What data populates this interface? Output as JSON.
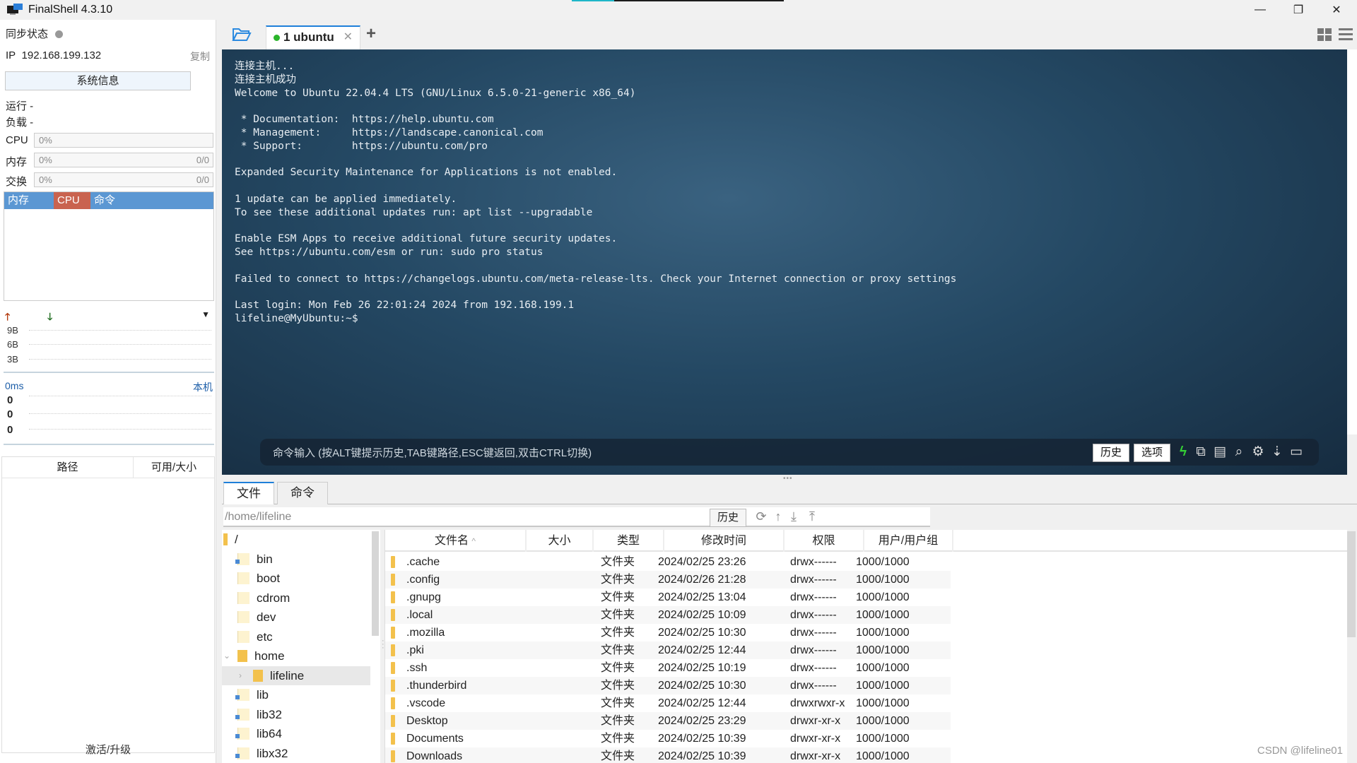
{
  "window": {
    "title": "FinalShell 4.3.10",
    "minimize_icon": "minimize-icon",
    "restore_icon": "restore-icon",
    "close_icon": "close-icon"
  },
  "left_panel": {
    "sync_label": "同步状态",
    "ip_label": "IP",
    "ip_value": "192.168.199.132",
    "copy_label": "复制",
    "sysinfo_button": "系统信息",
    "uptime_label": "运行 -",
    "load_label": "负载 -",
    "meters": [
      {
        "label": "CPU",
        "value": "0%",
        "extra": ""
      },
      {
        "label": "内存",
        "value": "0%",
        "extra": "0/0"
      },
      {
        "label": "交换",
        "value": "0%",
        "extra": "0/0"
      }
    ],
    "process_headers": [
      "内存",
      "CPU",
      "命令"
    ],
    "process_colors": {
      "mem": "#5b97d3",
      "cpu": "#c9634f",
      "cmd": "#5b97d3"
    },
    "network": {
      "ticks": [
        "9B",
        "6B",
        "3B"
      ]
    },
    "ping": {
      "latency": "0ms",
      "target": "本机",
      "values": [
        "0",
        "0",
        "0"
      ]
    },
    "disk_headers": [
      "路径",
      "可用/大小"
    ],
    "activate_label": "激活/升级"
  },
  "tabs": [
    {
      "label": "1 ubuntu",
      "status_color": "#2ab52a",
      "active": true
    }
  ],
  "terminal": {
    "lines": [
      "连接主机...",
      "连接主机成功",
      "Welcome to Ubuntu 22.04.4 LTS (GNU/Linux 6.5.0-21-generic x86_64)",
      "",
      " * Documentation:  https://help.ubuntu.com",
      " * Management:     https://landscape.canonical.com",
      " * Support:        https://ubuntu.com/pro",
      "",
      "Expanded Security Maintenance for Applications is not enabled.",
      "",
      "1 update can be applied immediately.",
      "To see these additional updates run: apt list --upgradable",
      "",
      "Enable ESM Apps to receive additional future security updates.",
      "See https://ubuntu.com/esm or run: sudo pro status",
      "",
      "Failed to connect to https://changelogs.ubuntu.com/meta-release-lts. Check your Internet connection or proxy settings",
      "",
      "Last login: Mon Feb 26 22:01:24 2024 from 192.168.199.1",
      "lifeline@MyUbuntu:~$"
    ],
    "command_placeholder": "命令输入 (按ALT键提示历史,TAB键路径,ESC键返回,双击CTRL切换)",
    "history_button": "历史",
    "options_button": "选项"
  },
  "bottom": {
    "tabs": [
      "文件",
      "命令"
    ],
    "path": "/home/lifeline",
    "history_button": "历史",
    "tree": [
      {
        "name": "/",
        "level": 0,
        "type": "root"
      },
      {
        "name": "bin",
        "level": 1,
        "type": "link"
      },
      {
        "name": "boot",
        "level": 1,
        "type": "folder"
      },
      {
        "name": "cdrom",
        "level": 1,
        "type": "folder"
      },
      {
        "name": "dev",
        "level": 1,
        "type": "folder"
      },
      {
        "name": "etc",
        "level": 1,
        "type": "folder"
      },
      {
        "name": "home",
        "level": 1,
        "type": "open",
        "expanded": true
      },
      {
        "name": "lifeline",
        "level": 2,
        "type": "open",
        "selected": true
      },
      {
        "name": "lib",
        "level": 1,
        "type": "link"
      },
      {
        "name": "lib32",
        "level": 1,
        "type": "link"
      },
      {
        "name": "lib64",
        "level": 1,
        "type": "link"
      },
      {
        "name": "libx32",
        "level": 1,
        "type": "link"
      }
    ],
    "file_headers": [
      "文件名",
      "大小",
      "类型",
      "修改时间",
      "权限",
      "用户/用户组"
    ],
    "files": [
      {
        "name": ".cache",
        "size": "",
        "type": "文件夹",
        "mtime": "2024/02/25 23:26",
        "perm": "drwx------",
        "owner": "1000/1000"
      },
      {
        "name": ".config",
        "size": "",
        "type": "文件夹",
        "mtime": "2024/02/26 21:28",
        "perm": "drwx------",
        "owner": "1000/1000"
      },
      {
        "name": ".gnupg",
        "size": "",
        "type": "文件夹",
        "mtime": "2024/02/25 13:04",
        "perm": "drwx------",
        "owner": "1000/1000"
      },
      {
        "name": ".local",
        "size": "",
        "type": "文件夹",
        "mtime": "2024/02/25 10:09",
        "perm": "drwx------",
        "owner": "1000/1000"
      },
      {
        "name": ".mozilla",
        "size": "",
        "type": "文件夹",
        "mtime": "2024/02/25 10:30",
        "perm": "drwx------",
        "owner": "1000/1000"
      },
      {
        "name": ".pki",
        "size": "",
        "type": "文件夹",
        "mtime": "2024/02/25 12:44",
        "perm": "drwx------",
        "owner": "1000/1000"
      },
      {
        "name": ".ssh",
        "size": "",
        "type": "文件夹",
        "mtime": "2024/02/25 10:19",
        "perm": "drwx------",
        "owner": "1000/1000"
      },
      {
        "name": ".thunderbird",
        "size": "",
        "type": "文件夹",
        "mtime": "2024/02/25 10:30",
        "perm": "drwx------",
        "owner": "1000/1000"
      },
      {
        "name": ".vscode",
        "size": "",
        "type": "文件夹",
        "mtime": "2024/02/25 12:44",
        "perm": "drwxrwxr-x",
        "owner": "1000/1000"
      },
      {
        "name": "Desktop",
        "size": "",
        "type": "文件夹",
        "mtime": "2024/02/25 23:29",
        "perm": "drwxr-xr-x",
        "owner": "1000/1000"
      },
      {
        "name": "Documents",
        "size": "",
        "type": "文件夹",
        "mtime": "2024/02/25 10:39",
        "perm": "drwxr-xr-x",
        "owner": "1000/1000"
      },
      {
        "name": "Downloads",
        "size": "",
        "type": "文件夹",
        "mtime": "2024/02/25 10:39",
        "perm": "drwxr-xr-x",
        "owner": "1000/1000"
      }
    ]
  },
  "watermark": "CSDN @lifeline01"
}
